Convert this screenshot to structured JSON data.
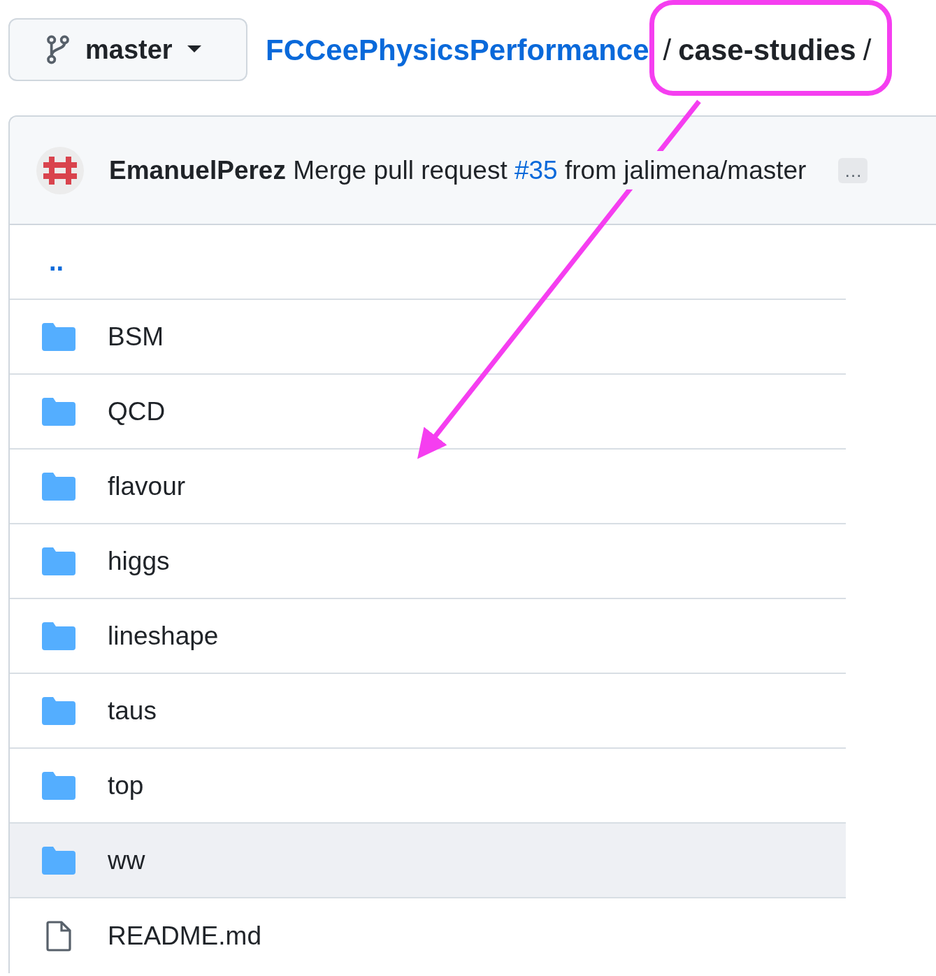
{
  "branch": {
    "name": "master"
  },
  "breadcrumb": {
    "repo": "FCCeePhysicsPerformance",
    "separator_1": "/",
    "path": "case-studies",
    "separator_2": "/"
  },
  "commit": {
    "author": "EmanuelPerez",
    "message_start": "Merge pull request",
    "pr_link": "#35",
    "message_end": "from jalimena/master",
    "more": "…"
  },
  "files": [
    {
      "kind": "parent",
      "name": "..",
      "highlighted": false
    },
    {
      "kind": "folder",
      "name": "BSM",
      "highlighted": false
    },
    {
      "kind": "folder",
      "name": "QCD",
      "highlighted": false
    },
    {
      "kind": "folder",
      "name": "flavour",
      "highlighted": false
    },
    {
      "kind": "folder",
      "name": "higgs",
      "highlighted": false
    },
    {
      "kind": "folder",
      "name": "lineshape",
      "highlighted": false
    },
    {
      "kind": "folder",
      "name": "taus",
      "highlighted": false
    },
    {
      "kind": "folder",
      "name": "top",
      "highlighted": false
    },
    {
      "kind": "folder",
      "name": "ww",
      "highlighted": true
    },
    {
      "kind": "file",
      "name": "README.md",
      "highlighted": false
    }
  ]
}
